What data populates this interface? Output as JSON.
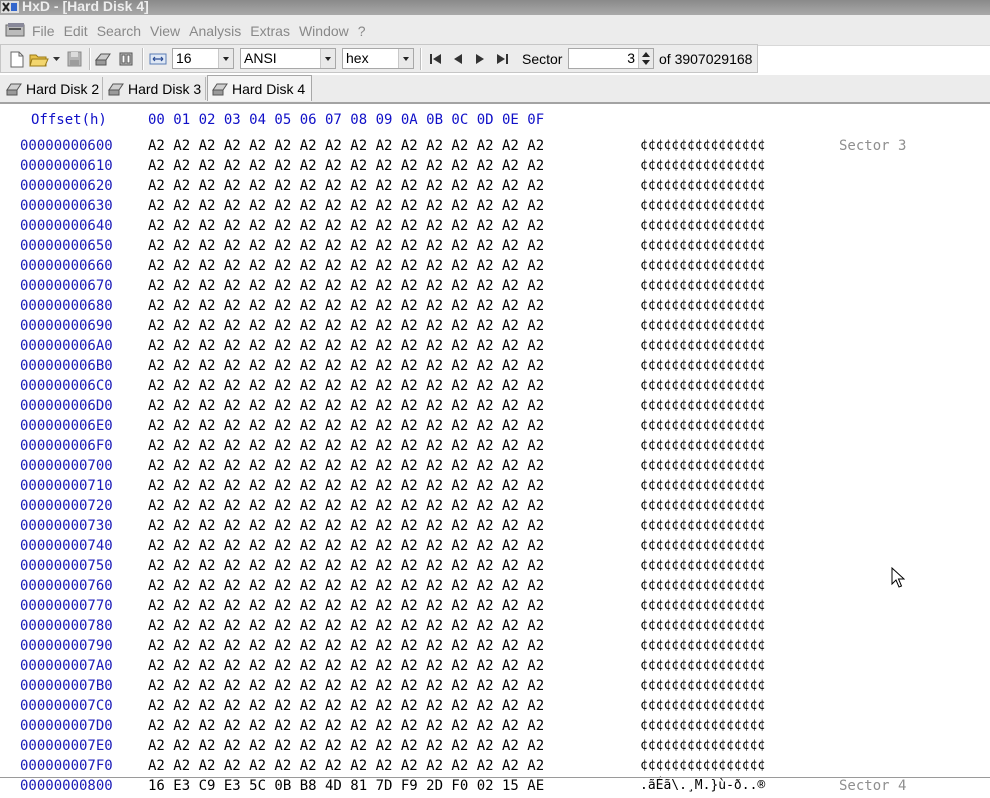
{
  "title": "HxD - [Hard Disk 4]",
  "menu": [
    "File",
    "Edit",
    "Search",
    "View",
    "Analysis",
    "Extras",
    "Window",
    "?"
  ],
  "toolbar": {
    "bytes_per_row": "16",
    "charset": "ANSI",
    "offset_base": "hex",
    "sector_label": "Sector",
    "sector_value": "3",
    "sector_total": "of 3907029168"
  },
  "tabs": [
    {
      "label": "Hard Disk 2",
      "active": false
    },
    {
      "label": "Hard Disk 3",
      "active": false
    },
    {
      "label": "Hard Disk 4",
      "active": true
    }
  ],
  "header": {
    "offset_label": "Offset(h)",
    "columns": "00 01 02 03 04 05 06 07 08 09 0A 0B 0C 0D 0E 0F"
  },
  "rows": [
    {
      "offset": "00000000600",
      "bytes": "A2 A2 A2 A2 A2 A2 A2 A2 A2 A2 A2 A2 A2 A2 A2 A2",
      "ascii": "¢¢¢¢¢¢¢¢¢¢¢¢¢¢¢¢",
      "sector": "Sector 3"
    },
    {
      "offset": "00000000610",
      "bytes": "A2 A2 A2 A2 A2 A2 A2 A2 A2 A2 A2 A2 A2 A2 A2 A2",
      "ascii": "¢¢¢¢¢¢¢¢¢¢¢¢¢¢¢¢",
      "sector": ""
    },
    {
      "offset": "00000000620",
      "bytes": "A2 A2 A2 A2 A2 A2 A2 A2 A2 A2 A2 A2 A2 A2 A2 A2",
      "ascii": "¢¢¢¢¢¢¢¢¢¢¢¢¢¢¢¢",
      "sector": ""
    },
    {
      "offset": "00000000630",
      "bytes": "A2 A2 A2 A2 A2 A2 A2 A2 A2 A2 A2 A2 A2 A2 A2 A2",
      "ascii": "¢¢¢¢¢¢¢¢¢¢¢¢¢¢¢¢",
      "sector": ""
    },
    {
      "offset": "00000000640",
      "bytes": "A2 A2 A2 A2 A2 A2 A2 A2 A2 A2 A2 A2 A2 A2 A2 A2",
      "ascii": "¢¢¢¢¢¢¢¢¢¢¢¢¢¢¢¢",
      "sector": ""
    },
    {
      "offset": "00000000650",
      "bytes": "A2 A2 A2 A2 A2 A2 A2 A2 A2 A2 A2 A2 A2 A2 A2 A2",
      "ascii": "¢¢¢¢¢¢¢¢¢¢¢¢¢¢¢¢",
      "sector": ""
    },
    {
      "offset": "00000000660",
      "bytes": "A2 A2 A2 A2 A2 A2 A2 A2 A2 A2 A2 A2 A2 A2 A2 A2",
      "ascii": "¢¢¢¢¢¢¢¢¢¢¢¢¢¢¢¢",
      "sector": ""
    },
    {
      "offset": "00000000670",
      "bytes": "A2 A2 A2 A2 A2 A2 A2 A2 A2 A2 A2 A2 A2 A2 A2 A2",
      "ascii": "¢¢¢¢¢¢¢¢¢¢¢¢¢¢¢¢",
      "sector": ""
    },
    {
      "offset": "00000000680",
      "bytes": "A2 A2 A2 A2 A2 A2 A2 A2 A2 A2 A2 A2 A2 A2 A2 A2",
      "ascii": "¢¢¢¢¢¢¢¢¢¢¢¢¢¢¢¢",
      "sector": ""
    },
    {
      "offset": "00000000690",
      "bytes": "A2 A2 A2 A2 A2 A2 A2 A2 A2 A2 A2 A2 A2 A2 A2 A2",
      "ascii": "¢¢¢¢¢¢¢¢¢¢¢¢¢¢¢¢",
      "sector": ""
    },
    {
      "offset": "000000006A0",
      "bytes": "A2 A2 A2 A2 A2 A2 A2 A2 A2 A2 A2 A2 A2 A2 A2 A2",
      "ascii": "¢¢¢¢¢¢¢¢¢¢¢¢¢¢¢¢",
      "sector": ""
    },
    {
      "offset": "000000006B0",
      "bytes": "A2 A2 A2 A2 A2 A2 A2 A2 A2 A2 A2 A2 A2 A2 A2 A2",
      "ascii": "¢¢¢¢¢¢¢¢¢¢¢¢¢¢¢¢",
      "sector": ""
    },
    {
      "offset": "000000006C0",
      "bytes": "A2 A2 A2 A2 A2 A2 A2 A2 A2 A2 A2 A2 A2 A2 A2 A2",
      "ascii": "¢¢¢¢¢¢¢¢¢¢¢¢¢¢¢¢",
      "sector": ""
    },
    {
      "offset": "000000006D0",
      "bytes": "A2 A2 A2 A2 A2 A2 A2 A2 A2 A2 A2 A2 A2 A2 A2 A2",
      "ascii": "¢¢¢¢¢¢¢¢¢¢¢¢¢¢¢¢",
      "sector": ""
    },
    {
      "offset": "000000006E0",
      "bytes": "A2 A2 A2 A2 A2 A2 A2 A2 A2 A2 A2 A2 A2 A2 A2 A2",
      "ascii": "¢¢¢¢¢¢¢¢¢¢¢¢¢¢¢¢",
      "sector": ""
    },
    {
      "offset": "000000006F0",
      "bytes": "A2 A2 A2 A2 A2 A2 A2 A2 A2 A2 A2 A2 A2 A2 A2 A2",
      "ascii": "¢¢¢¢¢¢¢¢¢¢¢¢¢¢¢¢",
      "sector": ""
    },
    {
      "offset": "00000000700",
      "bytes": "A2 A2 A2 A2 A2 A2 A2 A2 A2 A2 A2 A2 A2 A2 A2 A2",
      "ascii": "¢¢¢¢¢¢¢¢¢¢¢¢¢¢¢¢",
      "sector": ""
    },
    {
      "offset": "00000000710",
      "bytes": "A2 A2 A2 A2 A2 A2 A2 A2 A2 A2 A2 A2 A2 A2 A2 A2",
      "ascii": "¢¢¢¢¢¢¢¢¢¢¢¢¢¢¢¢",
      "sector": ""
    },
    {
      "offset": "00000000720",
      "bytes": "A2 A2 A2 A2 A2 A2 A2 A2 A2 A2 A2 A2 A2 A2 A2 A2",
      "ascii": "¢¢¢¢¢¢¢¢¢¢¢¢¢¢¢¢",
      "sector": ""
    },
    {
      "offset": "00000000730",
      "bytes": "A2 A2 A2 A2 A2 A2 A2 A2 A2 A2 A2 A2 A2 A2 A2 A2",
      "ascii": "¢¢¢¢¢¢¢¢¢¢¢¢¢¢¢¢",
      "sector": ""
    },
    {
      "offset": "00000000740",
      "bytes": "A2 A2 A2 A2 A2 A2 A2 A2 A2 A2 A2 A2 A2 A2 A2 A2",
      "ascii": "¢¢¢¢¢¢¢¢¢¢¢¢¢¢¢¢",
      "sector": ""
    },
    {
      "offset": "00000000750",
      "bytes": "A2 A2 A2 A2 A2 A2 A2 A2 A2 A2 A2 A2 A2 A2 A2 A2",
      "ascii": "¢¢¢¢¢¢¢¢¢¢¢¢¢¢¢¢",
      "sector": ""
    },
    {
      "offset": "00000000760",
      "bytes": "A2 A2 A2 A2 A2 A2 A2 A2 A2 A2 A2 A2 A2 A2 A2 A2",
      "ascii": "¢¢¢¢¢¢¢¢¢¢¢¢¢¢¢¢",
      "sector": ""
    },
    {
      "offset": "00000000770",
      "bytes": "A2 A2 A2 A2 A2 A2 A2 A2 A2 A2 A2 A2 A2 A2 A2 A2",
      "ascii": "¢¢¢¢¢¢¢¢¢¢¢¢¢¢¢¢",
      "sector": ""
    },
    {
      "offset": "00000000780",
      "bytes": "A2 A2 A2 A2 A2 A2 A2 A2 A2 A2 A2 A2 A2 A2 A2 A2",
      "ascii": "¢¢¢¢¢¢¢¢¢¢¢¢¢¢¢¢",
      "sector": ""
    },
    {
      "offset": "00000000790",
      "bytes": "A2 A2 A2 A2 A2 A2 A2 A2 A2 A2 A2 A2 A2 A2 A2 A2",
      "ascii": "¢¢¢¢¢¢¢¢¢¢¢¢¢¢¢¢",
      "sector": ""
    },
    {
      "offset": "000000007A0",
      "bytes": "A2 A2 A2 A2 A2 A2 A2 A2 A2 A2 A2 A2 A2 A2 A2 A2",
      "ascii": "¢¢¢¢¢¢¢¢¢¢¢¢¢¢¢¢",
      "sector": ""
    },
    {
      "offset": "000000007B0",
      "bytes": "A2 A2 A2 A2 A2 A2 A2 A2 A2 A2 A2 A2 A2 A2 A2 A2",
      "ascii": "¢¢¢¢¢¢¢¢¢¢¢¢¢¢¢¢",
      "sector": ""
    },
    {
      "offset": "000000007C0",
      "bytes": "A2 A2 A2 A2 A2 A2 A2 A2 A2 A2 A2 A2 A2 A2 A2 A2",
      "ascii": "¢¢¢¢¢¢¢¢¢¢¢¢¢¢¢¢",
      "sector": ""
    },
    {
      "offset": "000000007D0",
      "bytes": "A2 A2 A2 A2 A2 A2 A2 A2 A2 A2 A2 A2 A2 A2 A2 A2",
      "ascii": "¢¢¢¢¢¢¢¢¢¢¢¢¢¢¢¢",
      "sector": ""
    },
    {
      "offset": "000000007E0",
      "bytes": "A2 A2 A2 A2 A2 A2 A2 A2 A2 A2 A2 A2 A2 A2 A2 A2",
      "ascii": "¢¢¢¢¢¢¢¢¢¢¢¢¢¢¢¢",
      "sector": ""
    },
    {
      "offset": "000000007F0",
      "bytes": "A2 A2 A2 A2 A2 A2 A2 A2 A2 A2 A2 A2 A2 A2 A2 A2",
      "ascii": "¢¢¢¢¢¢¢¢¢¢¢¢¢¢¢¢",
      "sector": ""
    },
    {
      "offset": "00000000800",
      "bytes": "16 E3 C9 E3 5C 0B B8 4D 81 7D F9 2D F0 02 15 AE",
      "ascii": ".ãÉã\\.¸M.}ù-ð..®",
      "sector": "Sector 4"
    }
  ]
}
